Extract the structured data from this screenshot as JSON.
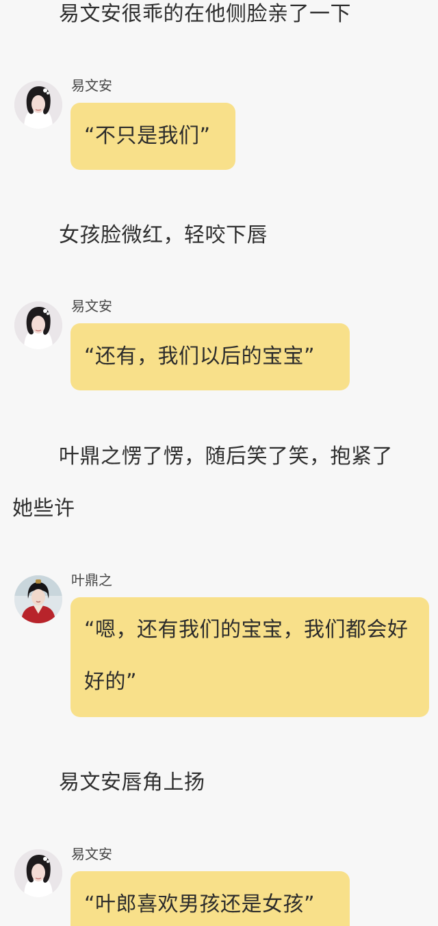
{
  "lines": {
    "narration_1": "易文安很乖的在他侧脸亲了一下",
    "narration_2": "女孩脸微红，轻咬下唇",
    "narration_3_line1": "叶鼎之愣了愣，随后笑了笑，抱紧了",
    "narration_3_line2": "她些许",
    "narration_4": "易文安唇角上扬"
  },
  "messages": [
    {
      "speaker": "易文安",
      "text": "“不只是我们”",
      "avatar": "female-avatar"
    },
    {
      "speaker": "易文安",
      "text": "“还有，我们以后的宝宝”",
      "avatar": "female-avatar"
    },
    {
      "speaker": "叶鼎之",
      "text": "“嗯，还有我们的宝宝，我们都会好好的”",
      "avatar": "male-avatar"
    },
    {
      "speaker": "易文安",
      "text": "“叶郎喜欢男孩还是女孩”",
      "avatar": "female-avatar"
    }
  ],
  "colors": {
    "background": "#f7f7f7",
    "bubble": "#f8e08a",
    "text": "#2b2b2b"
  }
}
